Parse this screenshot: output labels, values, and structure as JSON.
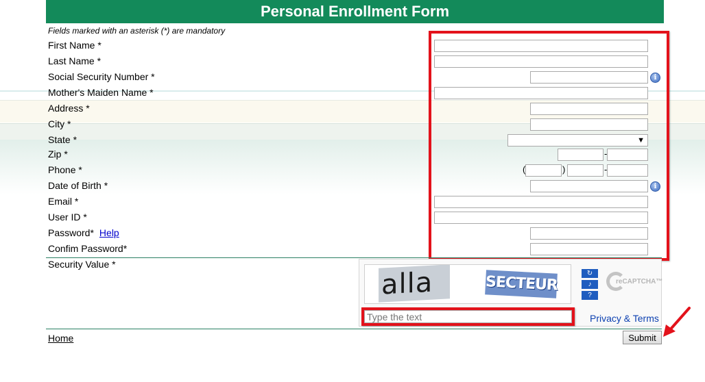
{
  "header": {
    "title": "Personal Enrollment Form"
  },
  "form": {
    "note": "Fields marked with an asterisk (*) are mandatory",
    "labels": {
      "first_name": "First Name *",
      "last_name": "Last Name *",
      "ssn": "Social Security Number *",
      "maiden_name": "Mother's Maiden Name *",
      "address": "Address *",
      "city": "City *",
      "state": "State *",
      "zip": "Zip *",
      "phone": "Phone *",
      "dob": "Date of Birth *",
      "email": "Email *",
      "user_id": "User ID *",
      "password": "Password*",
      "confirm_password": "Confim Password*",
      "security_value": "Security Value *"
    },
    "help_link": "Help",
    "zip_separator": "-",
    "phone_open_paren": "(",
    "phone_close_paren": ")",
    "phone_separator": "-",
    "state_selected": ""
  },
  "captcha": {
    "word1": "alla",
    "word2": "SECTEUR",
    "placeholder": "Type the text",
    "privacy_terms": "Privacy & Terms",
    "logo_text": "reCAPTCHA™",
    "refresh_icon": "↻",
    "audio_icon": "♪",
    "help_icon": "?"
  },
  "footer": {
    "home_link": "Home",
    "submit_label": "Submit"
  },
  "icons": {
    "info": "i",
    "dropdown": "▼"
  },
  "colors": {
    "header_bg": "#138a5a",
    "highlight": "#e3121b",
    "link": "#0000cc"
  }
}
